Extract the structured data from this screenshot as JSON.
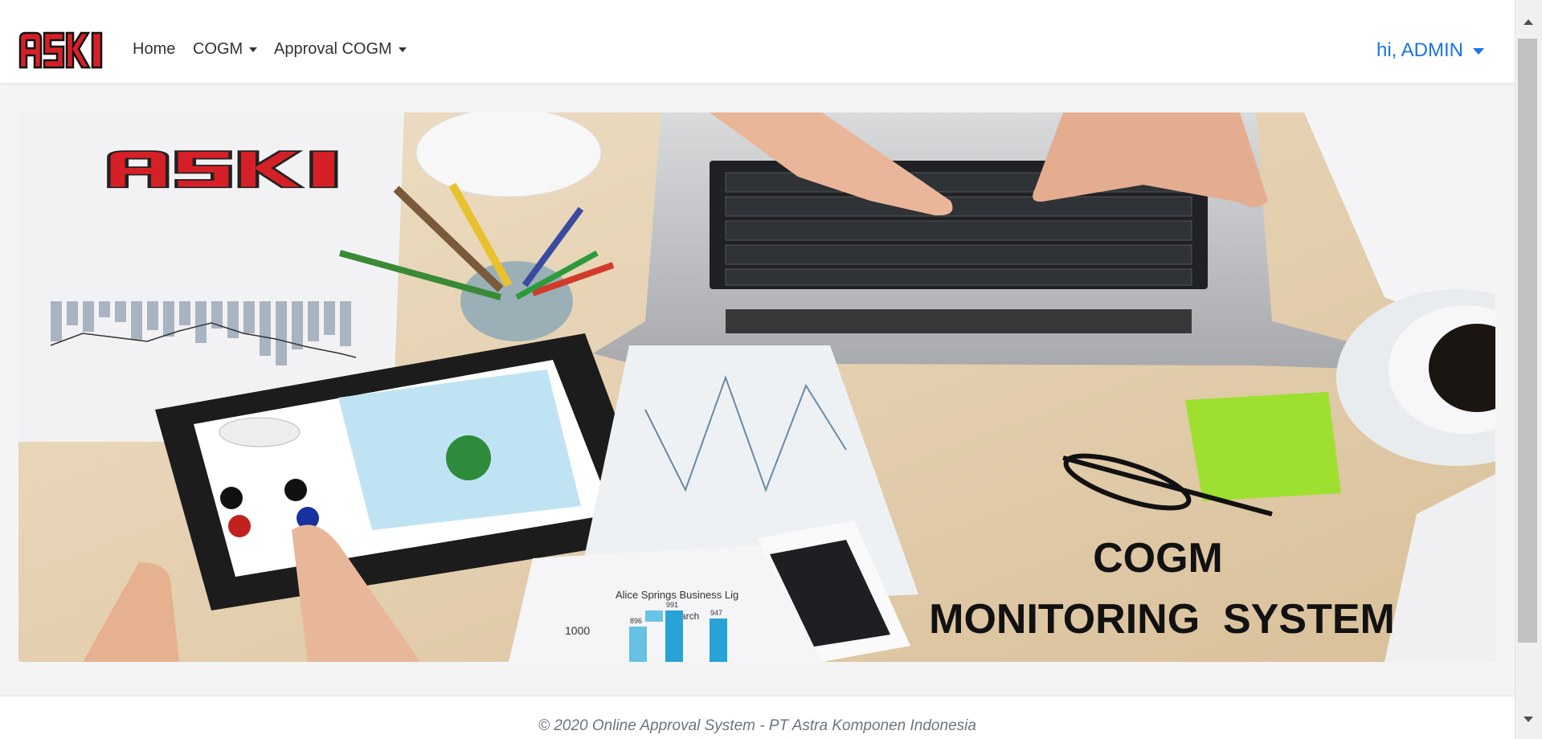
{
  "navbar": {
    "brand_text": "ASKI",
    "items": [
      {
        "label": "Home",
        "has_dropdown": false
      },
      {
        "label": "COGM",
        "has_dropdown": true
      },
      {
        "label": "Approval COGM",
        "has_dropdown": true
      }
    ],
    "user_label": "hi, ADMIN"
  },
  "banner": {
    "logo_text": "ASKI",
    "headline_line1": "COGM",
    "headline_line2": "MONITORING  SYSTEM",
    "chart_title": "Alice Springs Business Lig",
    "chart_legend": "March",
    "chart_axis_label": "1000",
    "chart_bar_labels": [
      "896",
      "991",
      "947"
    ]
  },
  "footer": {
    "text": "© 2020 Online Approval System - PT Astra Komponen Indonesia"
  },
  "colors": {
    "brand_red": "#d62027",
    "link_blue": "#1a73e8",
    "nav_text": "#333333"
  }
}
